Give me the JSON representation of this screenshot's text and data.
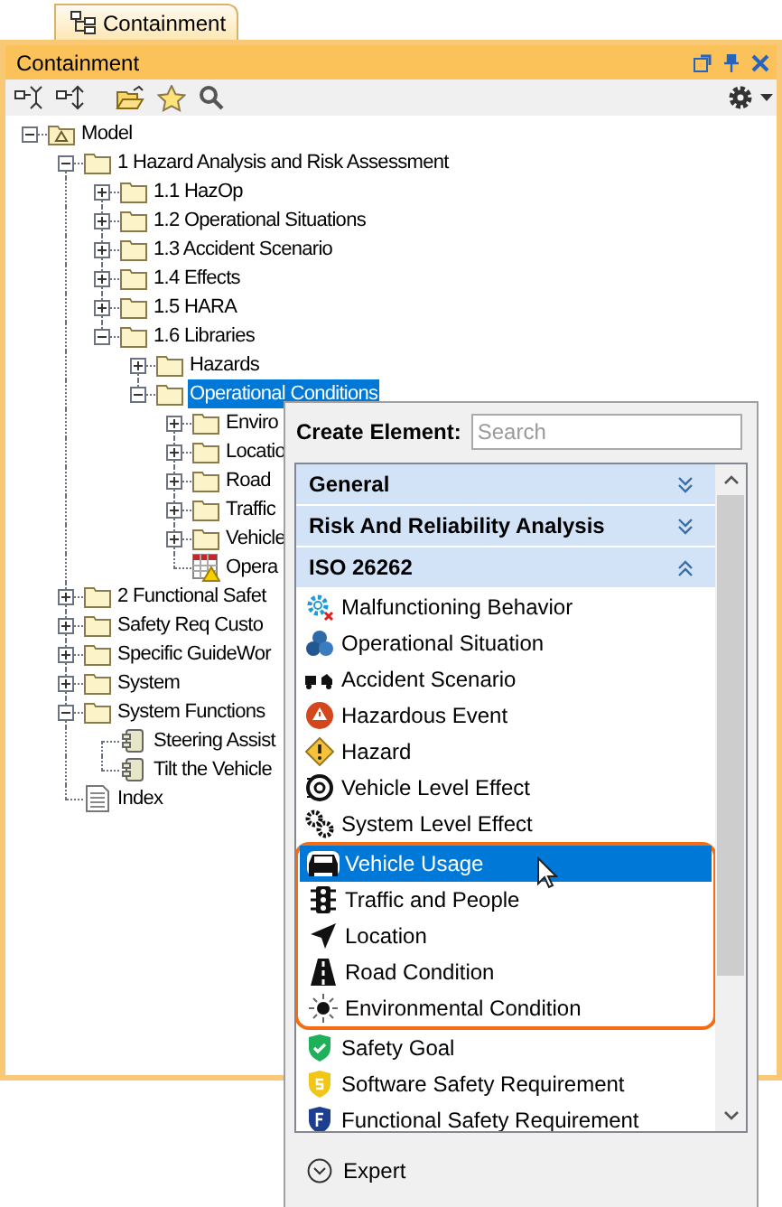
{
  "tab": {
    "label": "Containment"
  },
  "panel": {
    "title": "Containment"
  },
  "tree": [
    {
      "label": "Model",
      "kind": "model",
      "expanded": true,
      "selected": false,
      "children": [
        {
          "label": "1 Hazard Analysis and Risk Assessment",
          "kind": "folder",
          "expanded": true,
          "selected": false,
          "children": [
            {
              "label": "1.1 HazOp",
              "kind": "folder",
              "expanded": false,
              "selected": false
            },
            {
              "label": "1.2 Operational Situations",
              "kind": "folder",
              "expanded": false,
              "selected": false
            },
            {
              "label": "1.3 Accident Scenario",
              "kind": "folder",
              "expanded": false,
              "selected": false
            },
            {
              "label": "1.4 Effects",
              "kind": "folder",
              "expanded": false,
              "selected": false
            },
            {
              "label": "1.5 HARA",
              "kind": "folder",
              "expanded": false,
              "selected": false
            },
            {
              "label": "1.6 Libraries",
              "kind": "folder",
              "expanded": true,
              "selected": false,
              "children": [
                {
                  "label": "Hazards",
                  "kind": "folder",
                  "expanded": false,
                  "selected": false
                },
                {
                  "label": "Operational Conditions",
                  "kind": "folder",
                  "expanded": true,
                  "selected": true,
                  "children": [
                    {
                      "label": "Enviro",
                      "kind": "folder",
                      "expanded": false,
                      "selected": false
                    },
                    {
                      "label": "Locatio",
                      "kind": "folder",
                      "expanded": false,
                      "selected": false
                    },
                    {
                      "label": "Road",
                      "kind": "folder",
                      "expanded": false,
                      "selected": false
                    },
                    {
                      "label": "Traffic",
                      "kind": "folder",
                      "expanded": false,
                      "selected": false
                    },
                    {
                      "label": "Vehicle",
                      "kind": "folder",
                      "expanded": false,
                      "selected": false
                    },
                    {
                      "label": "Opera",
                      "kind": "table",
                      "selected": false
                    }
                  ]
                }
              ]
            }
          ]
        },
        {
          "label": "2 Functional Safet",
          "kind": "folder",
          "expanded": false,
          "selected": false
        },
        {
          "label": "Safety Req Custo",
          "kind": "folder",
          "expanded": false,
          "selected": false
        },
        {
          "label": "Specific GuideWor",
          "kind": "folder",
          "expanded": false,
          "selected": false
        },
        {
          "label": "System",
          "kind": "folder",
          "expanded": false,
          "selected": false
        },
        {
          "label": "System Functions",
          "kind": "folder",
          "expanded": true,
          "selected": false,
          "children": [
            {
              "label": "Steering Assist",
              "kind": "block",
              "selected": false
            },
            {
              "label": "Tilt the Vehicle",
              "kind": "block",
              "selected": false
            }
          ]
        },
        {
          "label": "Index",
          "kind": "document",
          "selected": false
        }
      ]
    }
  ],
  "popup": {
    "label": "Create Element:",
    "search": {
      "placeholder": "Search"
    },
    "categories": [
      {
        "label": "General",
        "expanded": false
      },
      {
        "label": "Risk And Reliability Analysis",
        "expanded": false
      },
      {
        "label": "ISO 26262",
        "expanded": true,
        "items": [
          {
            "label": "Malfunctioning Behavior",
            "selected": false,
            "highlighted": false
          },
          {
            "label": "Operational Situation",
            "selected": false,
            "highlighted": false
          },
          {
            "label": "Accident Scenario",
            "selected": false,
            "highlighted": false
          },
          {
            "label": "Hazardous Event",
            "selected": false,
            "highlighted": false
          },
          {
            "label": "Hazard",
            "selected": false,
            "highlighted": false
          },
          {
            "label": "Vehicle Level Effect",
            "selected": false,
            "highlighted": false
          },
          {
            "label": "System Level Effect",
            "selected": false,
            "highlighted": false
          },
          {
            "label": "Vehicle Usage",
            "selected": true,
            "highlighted": true
          },
          {
            "label": "Traffic and People",
            "selected": false,
            "highlighted": true
          },
          {
            "label": "Location",
            "selected": false,
            "highlighted": true
          },
          {
            "label": "Road Condition",
            "selected": false,
            "highlighted": true
          },
          {
            "label": "Environmental Condition",
            "selected": false,
            "highlighted": true
          },
          {
            "label": "Safety Goal",
            "selected": false,
            "highlighted": false
          },
          {
            "label": "Software Safety Requirement",
            "selected": false,
            "highlighted": false
          },
          {
            "label": "Functional Safety Requirement",
            "selected": false,
            "highlighted": false
          }
        ]
      }
    ],
    "expert": {
      "label": "Expert"
    }
  }
}
